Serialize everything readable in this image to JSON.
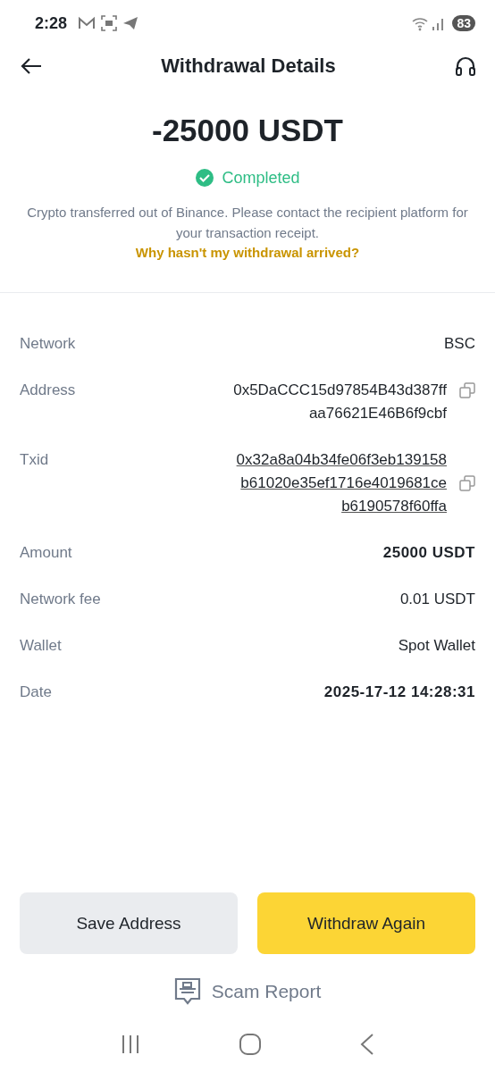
{
  "status_bar": {
    "time": "2:28",
    "battery": "83"
  },
  "header": {
    "title": "Withdrawal Details"
  },
  "summary": {
    "amount": "-25000 USDT",
    "status": "Completed",
    "completed": true,
    "message": "Crypto transferred out of Binance. Please contact the recipient platform for your transaction receipt.",
    "help_link": "Why hasn't my withdrawal arrived?"
  },
  "details": [
    {
      "label": "Network",
      "kind": "text",
      "lines": [
        "BSC"
      ]
    },
    {
      "label": "Address",
      "kind": "copy",
      "lines": [
        "0x5DaCCC15d97854B43d387ff",
        "aa76621E46B6f9cbf"
      ]
    },
    {
      "label": "Txid",
      "kind": "link",
      "lines": [
        "0x32a8a04b34fe06f3eb139158",
        "b61020e35ef1716e4019681ce",
        "b6190578f60ffa"
      ]
    },
    {
      "label": "Amount",
      "kind": "text",
      "lines": [
        "25000 USDT"
      ]
    },
    {
      "label": "Network fee",
      "kind": "text",
      "lines": [
        "0.01 USDT"
      ]
    },
    {
      "label": "Wallet",
      "kind": "text",
      "lines": [
        "Spot Wallet"
      ]
    },
    {
      "label": "Date",
      "kind": "text",
      "lines": [
        "2025-17-12 14:28:31"
      ]
    }
  ],
  "buttons": [
    {
      "label": "Save Address",
      "kind": "secondary"
    },
    {
      "label": "Withdraw Again",
      "kind": "primary"
    }
  ],
  "scam_report": {
    "label": "Scam Report"
  }
}
